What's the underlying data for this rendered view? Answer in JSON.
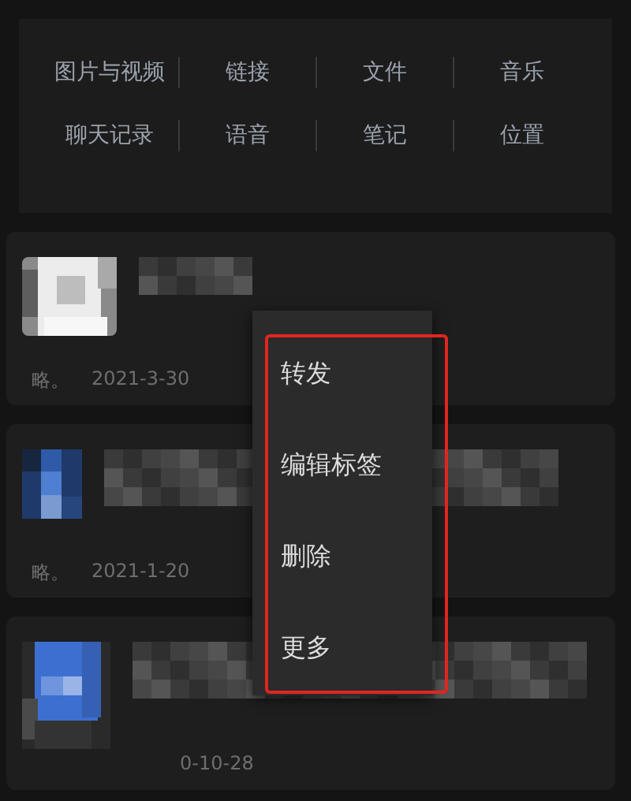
{
  "categories": [
    {
      "label": "图片与视频"
    },
    {
      "label": "链接"
    },
    {
      "label": "文件"
    },
    {
      "label": "音乐"
    },
    {
      "label": "聊天记录"
    },
    {
      "label": "语音"
    },
    {
      "label": "笔记"
    },
    {
      "label": "位置"
    }
  ],
  "items": [
    {
      "kind": "light",
      "source": "略。",
      "date": "2021-3-30"
    },
    {
      "kind": "blue",
      "source": "略。",
      "date": "2021-1-20"
    },
    {
      "kind": "wide",
      "date": "0-10-28"
    }
  ],
  "context_menu": {
    "highlighted": true,
    "items": [
      {
        "label": "转发"
      },
      {
        "label": "编辑标签"
      },
      {
        "label": "删除"
      },
      {
        "label": "更多"
      }
    ]
  }
}
